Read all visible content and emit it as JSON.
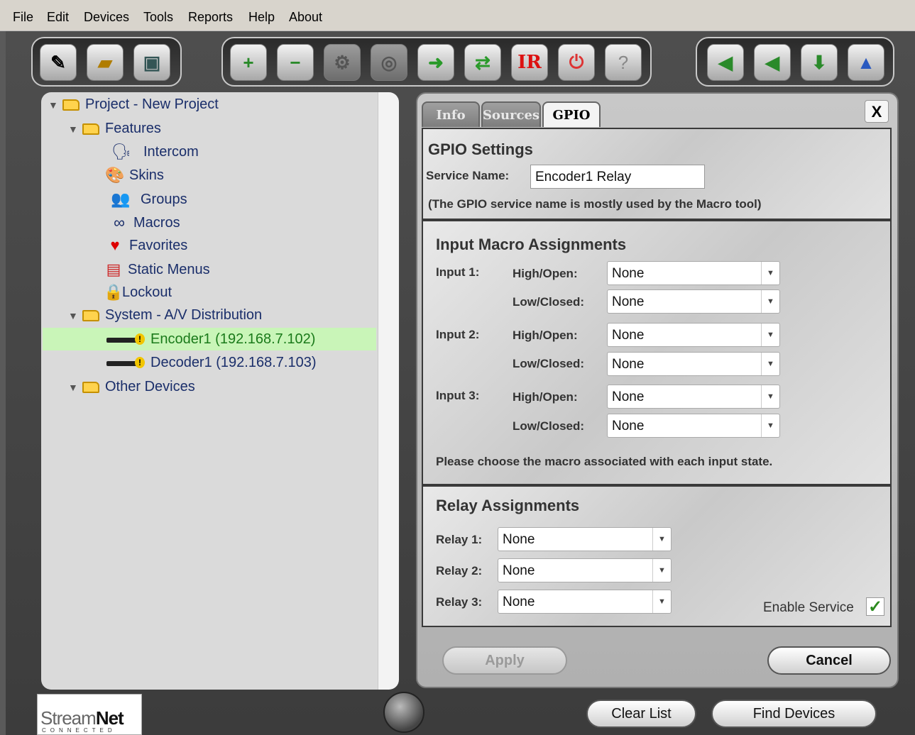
{
  "menu": [
    "File",
    "Edit",
    "Devices",
    "Tools",
    "Reports",
    "Help",
    "About"
  ],
  "toolbar": {
    "group1": [
      "new-project-icon",
      "open-project-icon",
      "save-icon"
    ],
    "group2": [
      "add-device-icon",
      "remove-device-icon",
      "disabled-device-icon",
      "fingerprint-icon",
      "network-icon",
      "refresh-icon",
      "ir-icon",
      "power-icon",
      "help-icon"
    ],
    "ir_label": "IR",
    "help_label": "?",
    "group3": [
      "back-icon",
      "forward-icon",
      "download-icon",
      "wizard-icon"
    ]
  },
  "tree": {
    "project": "Project - New Project",
    "features": "Features",
    "feature_items": [
      "Intercom",
      "Skins",
      "Groups",
      "Macros",
      "Favorites",
      "Static Menus",
      "Lockout"
    ],
    "system": "System - A/V Distribution",
    "encoder": "Encoder1 (192.168.7.102)",
    "decoder": "Decoder1 (192.168.7.103)",
    "other": "Other Devices"
  },
  "tabs": [
    "Info",
    "Sources",
    "GPIO"
  ],
  "close_label": "X",
  "gpio": {
    "title": "GPIO Settings",
    "service_label": "Service Name:",
    "service_value": "Encoder1 Relay",
    "service_note": "(The GPIO service name is mostly used by the Macro tool)"
  },
  "input_macros": {
    "title": "Input Macro Assignments",
    "inputs": [
      {
        "label": "Input 1:",
        "high_label": "High/Open:",
        "high": "None",
        "low_label": "Low/Closed:",
        "low": "None"
      },
      {
        "label": "Input 2:",
        "high_label": "High/Open:",
        "high": "None",
        "low_label": "Low/Closed:",
        "low": "None"
      },
      {
        "label": "Input 3:",
        "high_label": "High/Open:",
        "high": "None",
        "low_label": "Low/Closed:",
        "low": "None"
      }
    ],
    "note": "Please choose the macro associated with each input state."
  },
  "relays": {
    "title": "Relay Assignments",
    "items": [
      {
        "label": "Relay 1:",
        "value": "None"
      },
      {
        "label": "Relay 2:",
        "value": "None"
      },
      {
        "label": "Relay 3:",
        "value": "None"
      }
    ],
    "enable_label": "Enable Service",
    "enabled": true
  },
  "buttons": {
    "apply": "Apply",
    "cancel": "Cancel",
    "clear": "Clear List",
    "find": "Find Devices"
  },
  "logo": {
    "brand_a": "Stream",
    "brand_b": "Net",
    "tag": "CONNECTED"
  }
}
